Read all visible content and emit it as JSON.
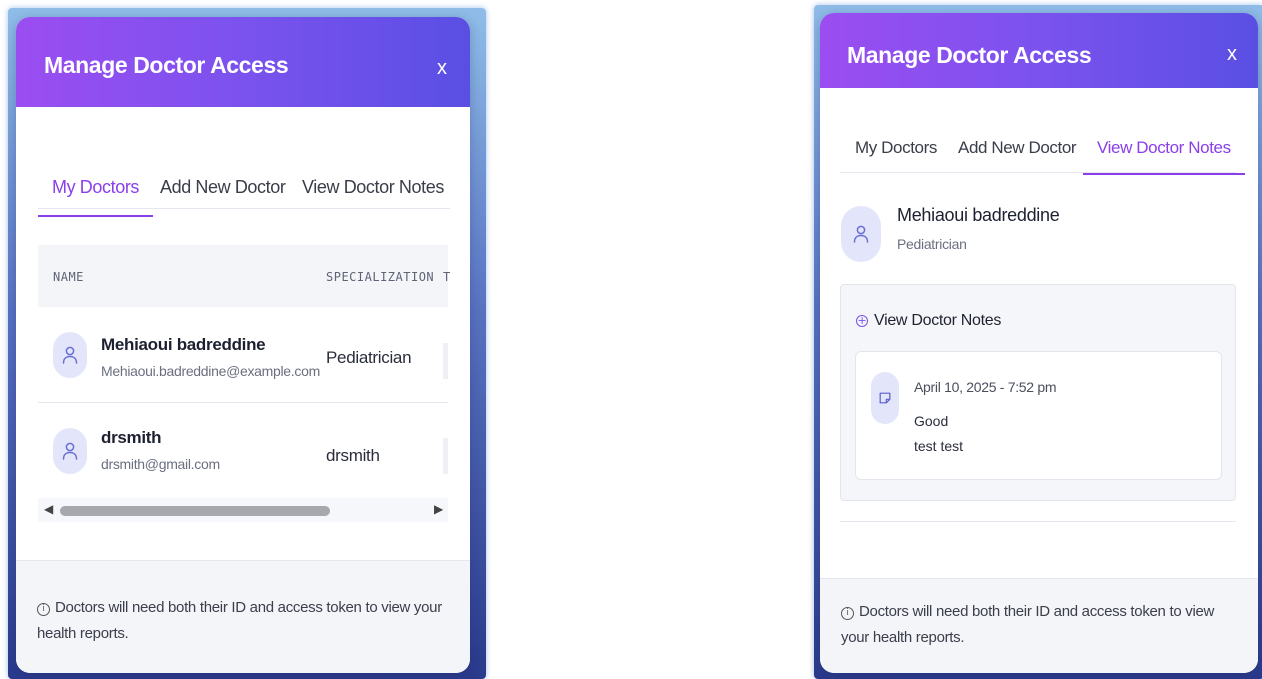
{
  "modal_title": "Manage Doctor Access",
  "close_label": "x",
  "tabs": [
    "My Doctors",
    "Add New Doctor",
    "View Doctor Notes"
  ],
  "left_panel": {
    "active_tab": "My Doctors",
    "table": {
      "headers": [
        "NAME",
        "SPECIALIZATION",
        "T"
      ],
      "rows": [
        {
          "name": "Mehiaoui badreddine",
          "email": "Mehiaoui.badreddine@example.com",
          "specialization": "Pediatrician"
        },
        {
          "name": "drsmith",
          "email": "drsmith@gmail.com",
          "specialization": "drsmith"
        }
      ]
    },
    "scrollbar": {
      "left_arrow": "◀",
      "right_arrow": "▶"
    }
  },
  "right_panel": {
    "active_tab": "View Doctor Notes",
    "doctor": {
      "name": "Mehiaoui badreddine",
      "specialization": "Pediatrician"
    },
    "notes_toggle_label": "View Doctor Notes",
    "note": {
      "date": "April 10, 2025 - 7:52 pm",
      "lines": [
        "Good",
        "test test"
      ]
    }
  },
  "footer_text": "Doctors will need both their ID and access token to view your health reports.",
  "icons": {
    "close": "close-icon",
    "avatar": "user-icon",
    "info": "info-icon",
    "plus": "plus-circle-icon",
    "note": "sticky-note-icon"
  },
  "colors": {
    "header_gradient_start": "#9b4df1",
    "header_gradient_end": "#5a4fe3",
    "active_tab": "#8a3fe8",
    "avatar_bg": "#e3e6fb"
  }
}
